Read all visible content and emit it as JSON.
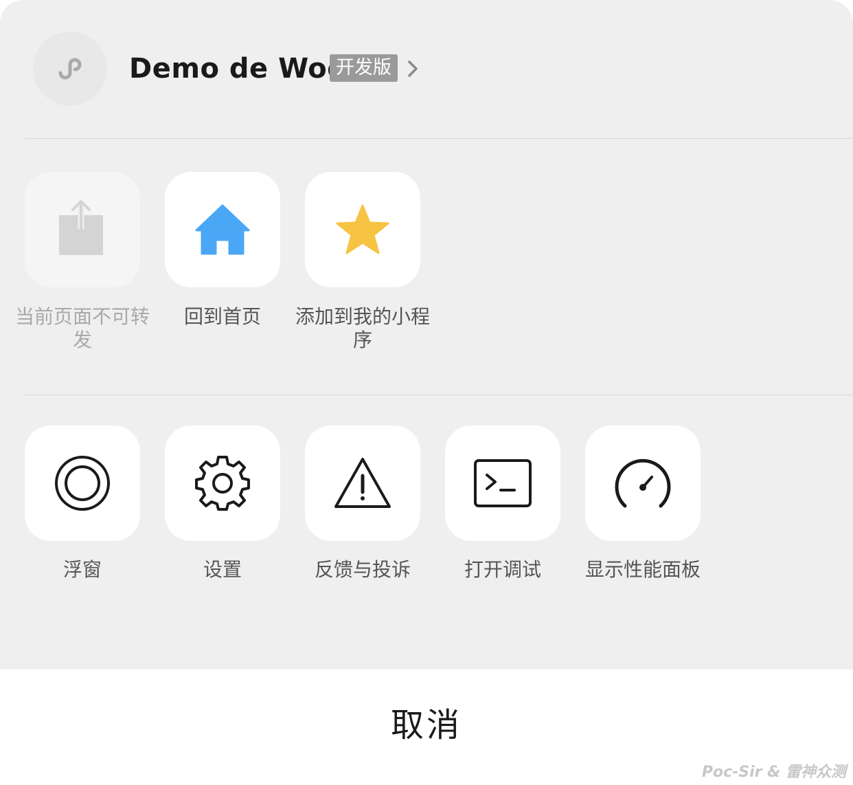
{
  "header": {
    "app_name": "Demo de Woo",
    "badge": "开发版"
  },
  "row1": [
    {
      "label": "当前页面不可转发",
      "icon": "share-icon",
      "enabled": false
    },
    {
      "label": "回到首页",
      "icon": "home-icon",
      "enabled": true
    },
    {
      "label": "添加到我的小程序",
      "icon": "star-icon",
      "enabled": true
    }
  ],
  "row2": [
    {
      "label": "浮窗",
      "icon": "floating-window-icon",
      "enabled": true
    },
    {
      "label": "设置",
      "icon": "gear-icon",
      "enabled": true
    },
    {
      "label": "反馈与投诉",
      "icon": "warning-icon",
      "enabled": true
    },
    {
      "label": "打开调试",
      "icon": "terminal-icon",
      "enabled": true
    },
    {
      "label": "显示性能面板",
      "icon": "gauge-icon",
      "enabled": true
    }
  ],
  "cancel_label": "取消",
  "watermark": "Poc-Sir & 雷神众测",
  "colors": {
    "home_icon": "#4aa7f6",
    "star_icon": "#f6c343",
    "sheet_background": "#efefef",
    "badge_background": "#9a9a9a"
  }
}
